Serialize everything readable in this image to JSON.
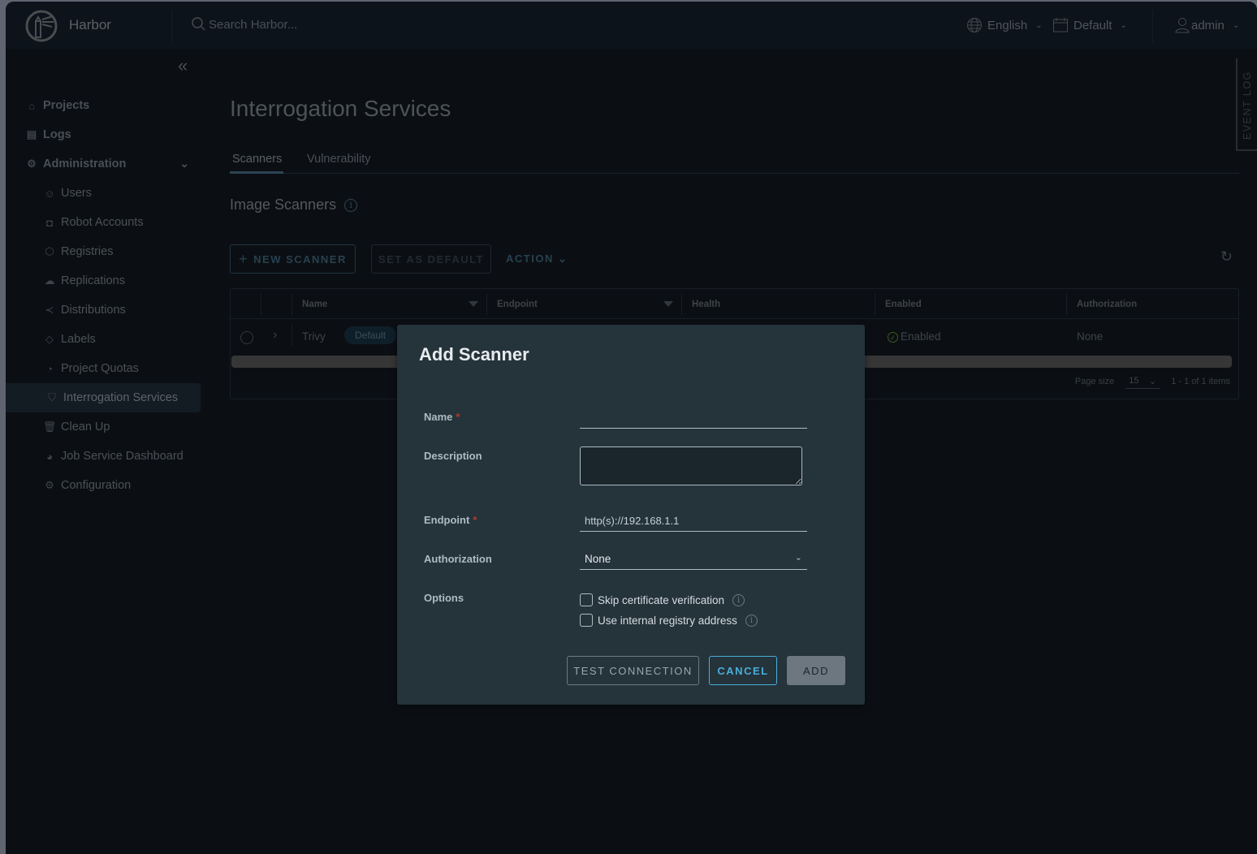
{
  "header": {
    "brand": "Harbor",
    "search_placeholder": "Search Harbor...",
    "language": "English",
    "theme": "Default",
    "user": "admin"
  },
  "sidebar": {
    "items": [
      {
        "label": "Projects",
        "icon": "projects-icon"
      },
      {
        "label": "Logs",
        "icon": "logs-icon"
      },
      {
        "label": "Administration",
        "icon": "admin-icon"
      }
    ],
    "admin_items": [
      {
        "label": "Users",
        "icon": "users-icon"
      },
      {
        "label": "Robot Accounts",
        "icon": "robot-icon"
      },
      {
        "label": "Registries",
        "icon": "registry-icon"
      },
      {
        "label": "Replications",
        "icon": "replication-icon"
      },
      {
        "label": "Distributions",
        "icon": "share-icon"
      },
      {
        "label": "Labels",
        "icon": "tag-icon"
      },
      {
        "label": "Project Quotas",
        "icon": "quota-icon"
      },
      {
        "label": "Interrogation Services",
        "icon": "shield-icon",
        "active": true
      },
      {
        "label": "Clean Up",
        "icon": "trash-icon"
      },
      {
        "label": "Job Service Dashboard",
        "icon": "dashboard-icon"
      },
      {
        "label": "Configuration",
        "icon": "gear-icon"
      }
    ]
  },
  "main": {
    "title": "Interrogation Services",
    "tabs": [
      {
        "label": "Scanners",
        "active": true
      },
      {
        "label": "Vulnerability",
        "active": false
      }
    ],
    "section_title": "Image Scanners",
    "toolbar": {
      "new_scanner": "NEW SCANNER",
      "set_default": "SET AS DEFAULT",
      "action": "ACTION"
    },
    "table": {
      "columns": [
        "Name",
        "Endpoint",
        "Health",
        "Enabled",
        "Authorization"
      ],
      "rows": [
        {
          "name": "Trivy",
          "badge": "Default",
          "endpoint": "",
          "health": "",
          "enabled": "Enabled",
          "authorization": "None"
        }
      ],
      "page_size_label": "Page size",
      "page_size": "15",
      "pagination": "1 - 1 of 1 items"
    }
  },
  "event_log": "EVENT LOG",
  "modal": {
    "title": "Add Scanner",
    "fields": {
      "name_label": "Name",
      "name_value": "",
      "description_label": "Description",
      "description_value": "",
      "endpoint_label": "Endpoint",
      "endpoint_placeholder": "http(s)://192.168.1.1",
      "authorization_label": "Authorization",
      "authorization_value": "None",
      "options_label": "Options",
      "option_skip_cert": "Skip certificate verification",
      "option_internal_registry": "Use internal registry address",
      "required_mark": "*"
    },
    "buttons": {
      "test": "TEST CONNECTION",
      "cancel": "CANCEL",
      "add": "ADD"
    }
  }
}
